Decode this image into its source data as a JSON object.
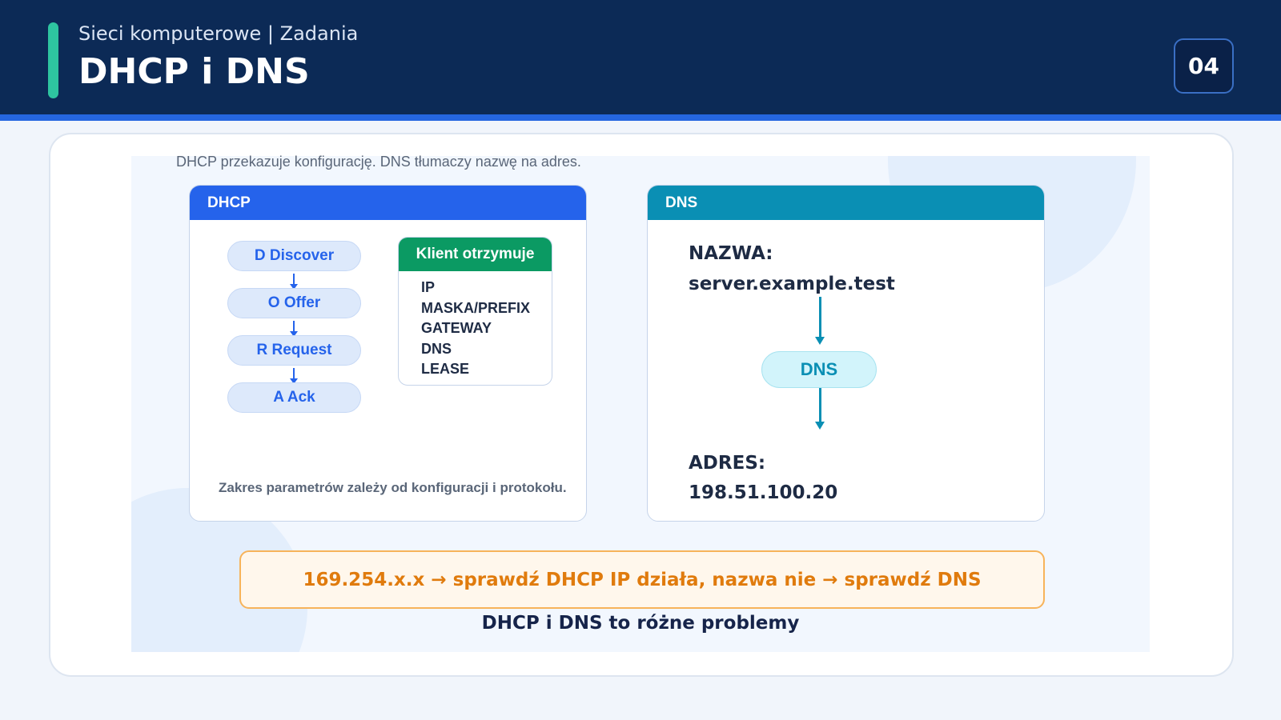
{
  "header": {
    "subtitle": "Sieci komputerowe | Zadania",
    "title": "DHCP i DNS",
    "page_number": "04"
  },
  "intro": "DHCP przekazuje konfigurację. DNS tłumaczy nazwę na adres.",
  "dhcp": {
    "title": "DHCP",
    "steps": [
      "D Discover",
      "O Offer",
      "R Request",
      "A Ack"
    ],
    "client": {
      "title": "Klient otrzymuje",
      "items": [
        "IP",
        "MASKA/PREFIX",
        "GATEWAY",
        "DNS",
        "LEASE"
      ]
    },
    "note": "Zakres parametrów zależy od konfiguracji i protokołu."
  },
  "dns": {
    "title": "DNS",
    "name_label": "NAZWA:",
    "name_value": "server.example.test",
    "node": "DNS",
    "address_label": "ADRES:",
    "address_value": "198.51.100.20"
  },
  "hint": "169.254.x.x → sprawdź DHCP IP działa, nazwa nie → sprawdź DNS",
  "footer": "DHCP i DNS to różne problemy"
}
